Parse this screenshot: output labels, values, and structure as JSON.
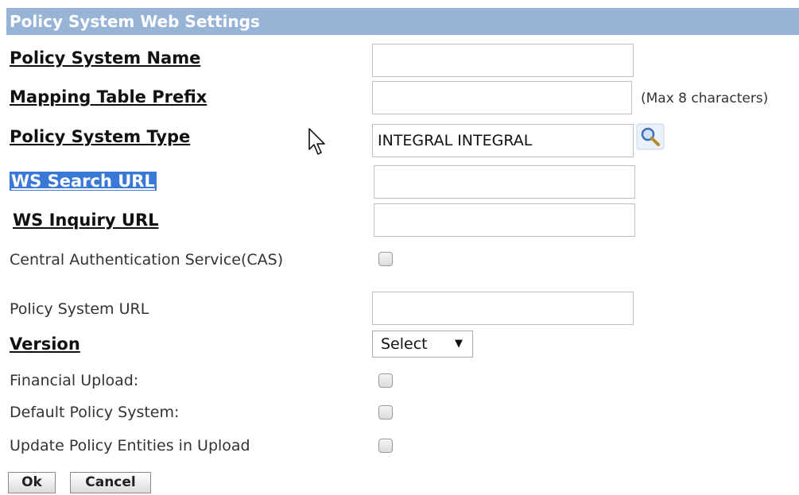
{
  "header": {
    "title": "Policy System Web Settings"
  },
  "fields": {
    "policy_system_name": {
      "label": "Policy System Name",
      "value": ""
    },
    "mapping_table_prefix": {
      "label": "Mapping Table Prefix",
      "value": "",
      "hint": "(Max 8 characters)"
    },
    "policy_system_type": {
      "label": "Policy System Type",
      "value": "INTEGRAL INTEGRAL"
    },
    "ws_search_url": {
      "label": "WS Search URL",
      "value": ""
    },
    "ws_inquiry_url": {
      "label": "WS Inquiry URL",
      "value": ""
    },
    "cas": {
      "label": "Central Authentication Service(CAS)",
      "checked": false
    },
    "policy_system_url": {
      "label": "Policy System URL",
      "value": ""
    },
    "version": {
      "label": "Version",
      "selected": "Select"
    },
    "financial_upload": {
      "label": "Financial Upload:",
      "checked": false
    },
    "default_policy_system": {
      "label": "Default Policy System:",
      "checked": false
    },
    "update_policy_entities": {
      "label": "Update Policy Entities in Upload",
      "checked": false
    }
  },
  "buttons": {
    "ok": "Ok",
    "cancel": "Cancel"
  },
  "icons": {
    "lookup": "magnifier-icon",
    "cursor": "mouse-pointer-icon"
  },
  "colors": {
    "header_bg": "#97b3d6",
    "highlight": "#3a78d6"
  }
}
